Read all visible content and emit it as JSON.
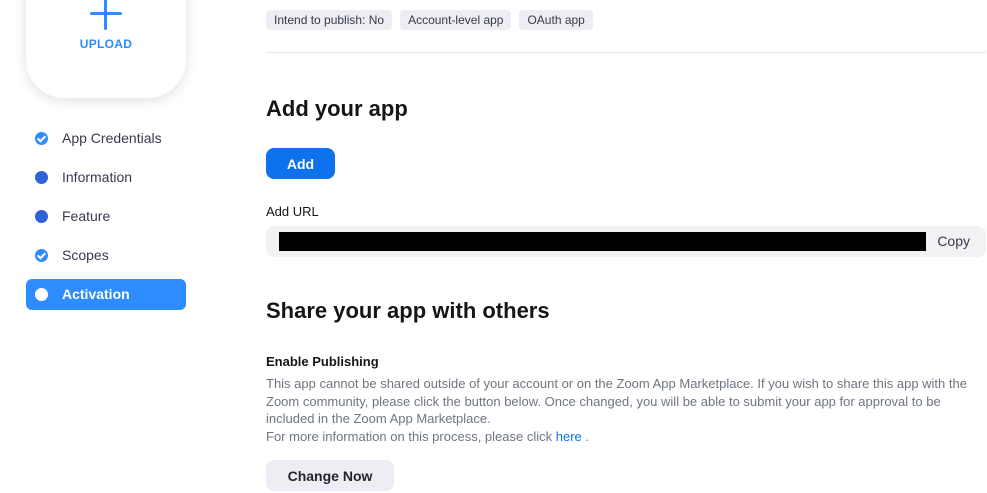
{
  "upload": {
    "label": "UPLOAD",
    "icon": "plus-icon"
  },
  "sidebar": {
    "items": [
      {
        "label": "App Credentials",
        "state": "completed"
      },
      {
        "label": "Information",
        "state": "pending"
      },
      {
        "label": "Feature",
        "state": "pending"
      },
      {
        "label": "Scopes",
        "state": "completed"
      },
      {
        "label": "Activation",
        "state": "active"
      }
    ]
  },
  "tags": [
    "Intend to publish: No",
    "Account-level app",
    "OAuth app"
  ],
  "add_app": {
    "title": "Add your app",
    "button": "Add",
    "url_label": "Add URL",
    "url_value": "",
    "copy": "Copy"
  },
  "share": {
    "title": "Share your app with others",
    "subtitle": "Enable Publishing",
    "description": "This app cannot be shared outside of your account or on the Zoom App Marketplace. If you wish to share this app with the Zoom community, please click the button below. Once changed, you will be able to submit your app for approval to be included in the Zoom App Marketplace.",
    "more_prefix": "For more information on this process, please click",
    "more_link": "here",
    "more_suffix": ".",
    "button": "Change Now"
  },
  "colors": {
    "accent": "#2d8cff",
    "primary_button": "#0e72ed"
  }
}
